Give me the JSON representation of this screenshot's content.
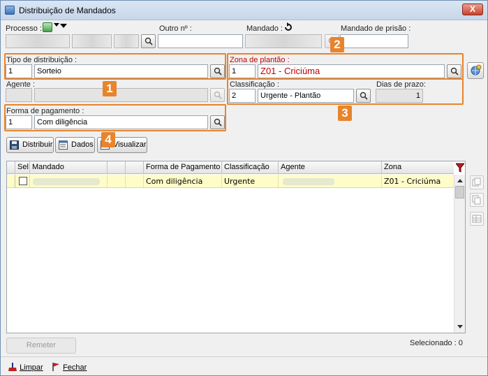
{
  "window": {
    "title": "Distribuição de Mandados",
    "close_label": "X"
  },
  "labels": {
    "processo": "Processo :",
    "outro": "Outro nº :",
    "mandado": "Mandado :",
    "mandado_prisao": "Mandado de prisão :",
    "tipo_distribuicao": "Tipo de distribuição :",
    "zona_plantao": "Zona de plantão :",
    "agente": "Agente :",
    "classificacao": "Classificação :",
    "dias_prazo": "Dias de prazo:",
    "forma_pagamento": "Forma de pagamento :"
  },
  "fields": {
    "tipo_code": "1",
    "tipo_name": "Sorteio",
    "zona_code": "1",
    "zona_name": "Z01 - Criciúma",
    "classificacao_code": "2",
    "classificacao_name": "Urgente - Plantão",
    "dias_prazo": "1",
    "forma_code": "1",
    "forma_name": "Com diligência"
  },
  "callouts": [
    "1",
    "2",
    "3",
    "4"
  ],
  "toolbar": {
    "distribuir": "Distribuir",
    "dados": "Dados",
    "visualizar": "Visualizar"
  },
  "table": {
    "columns": [
      "Sel",
      "Mandado",
      "",
      "",
      "Forma de Pagamento",
      "Classificação",
      "Agente",
      "Zona"
    ],
    "rows": [
      {
        "forma": "Com diligência",
        "classificacao": "Urgente",
        "zona": "Z01 - Criciúma"
      }
    ]
  },
  "footer": {
    "remeter": "Remeter",
    "selecionado": "Selecionado : 0",
    "limpar": "Limpar",
    "fechar": "Fechar"
  },
  "colors": {
    "callout": "#e8842c",
    "highlight_row": "#fefcc8",
    "zona_text": "#c00000"
  }
}
